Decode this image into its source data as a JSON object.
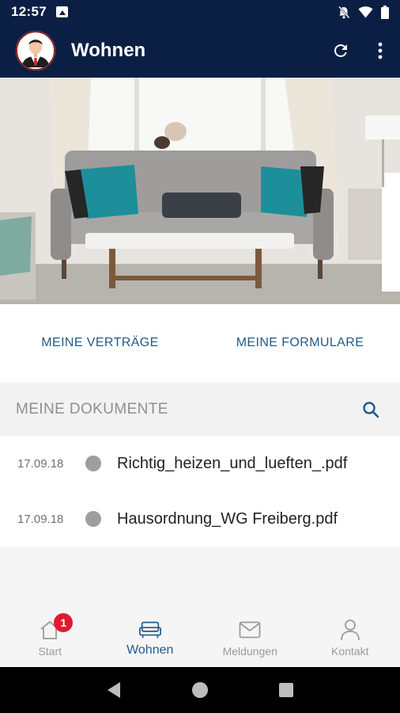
{
  "status_bar": {
    "time": "12:57",
    "icons": [
      "image-icon",
      "notifications-off-icon",
      "wifi-icon",
      "battery-icon"
    ]
  },
  "app_bar": {
    "title": "Wohnen",
    "actions": [
      "refresh-icon",
      "more-vert-icon"
    ]
  },
  "hero": {
    "description_icon": "living-room-photo"
  },
  "quick_links": {
    "contracts": "MEINE VERTRÄGE",
    "forms": "MEINE FORMULARE"
  },
  "documents": {
    "title": "MEINE DOKUMENTE",
    "items": [
      {
        "date": "17.09.18",
        "name": "Richtig_heizen_und_lueften_.pdf"
      },
      {
        "date": "17.09.18",
        "name": "Hausordnung_WG Freiberg.pdf"
      }
    ]
  },
  "bottom_nav": {
    "items": [
      {
        "label": "Start",
        "icon": "home-icon",
        "badge": "1"
      },
      {
        "label": "Wohnen",
        "icon": "sofa-icon",
        "active": true
      },
      {
        "label": "Meldungen",
        "icon": "mail-icon"
      },
      {
        "label": "Kontakt",
        "icon": "person-icon"
      }
    ]
  },
  "colors": {
    "primary": "#0b1f45",
    "accent": "#1f5a8c",
    "badge": "#e0192f"
  }
}
